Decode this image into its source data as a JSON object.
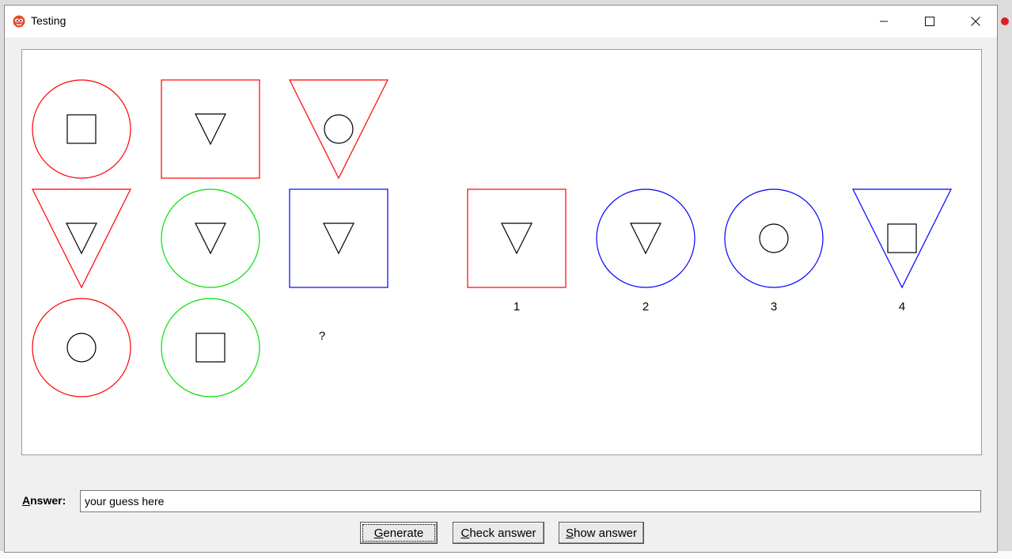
{
  "window": {
    "title": "Testing",
    "controls": {
      "minimize": "—",
      "maximize": "☐",
      "close": "✕"
    }
  },
  "puzzle": {
    "grid": [
      [
        {
          "outer": "circle",
          "color": "#ff0000",
          "inner": "square"
        },
        {
          "outer": "square",
          "color": "#ff0000",
          "inner": "triangle"
        },
        {
          "outer": "triangle",
          "color": "#ff0000",
          "inner": "circle"
        }
      ],
      [
        {
          "outer": "triangle",
          "color": "#ff0000",
          "inner": "triangle"
        },
        {
          "outer": "circle",
          "color": "#00e000",
          "inner": "triangle"
        },
        {
          "outer": "square",
          "color": "#0000ff",
          "inner": "triangle"
        }
      ],
      [
        {
          "outer": "circle",
          "color": "#ff0000",
          "inner": "circle"
        },
        {
          "outer": "circle",
          "color": "#00e000",
          "inner": "square"
        },
        null
      ]
    ],
    "question_mark": "?",
    "options": [
      {
        "label": "1",
        "outer": "square",
        "color": "#ff0000",
        "inner": "triangle"
      },
      {
        "label": "2",
        "outer": "circle",
        "color": "#0000ff",
        "inner": "triangle"
      },
      {
        "label": "3",
        "outer": "circle",
        "color": "#0000ff",
        "inner": "circle"
      },
      {
        "label": "4",
        "outer": "triangle",
        "color": "#0000ff",
        "inner": "square"
      }
    ]
  },
  "answer": {
    "label_underlined": "A",
    "label_rest": "nswer:",
    "value": "your guess here"
  },
  "buttons": {
    "generate": {
      "u": "G",
      "rest": "enerate"
    },
    "check": {
      "u": "C",
      "rest": "heck answer"
    },
    "show": {
      "u": "S",
      "rest": "how answer"
    }
  }
}
